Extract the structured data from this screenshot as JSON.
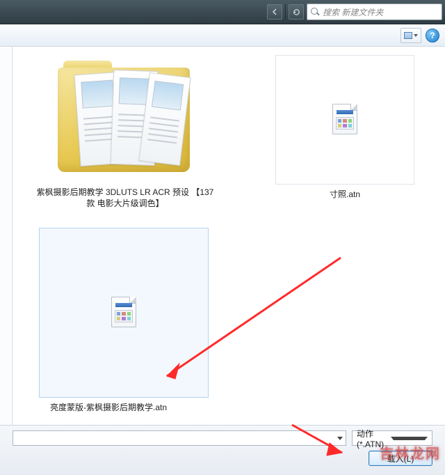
{
  "titlebar": {
    "search_placeholder": "搜索 新建文件夹"
  },
  "toolbar": {
    "help_label": "?"
  },
  "files": {
    "folder1_label": "紫枫摄影后期教学 3DLUTS LR ACR 预设 【137款 电影大片级调色】",
    "atn_right_label": "寸照.atn",
    "atn_selected_label": "亮度蒙版-紫枫摄影后期教学.atn"
  },
  "bottom": {
    "filter_label": "动作 (*.ATN)",
    "load_label": "载入(L)"
  },
  "watermark": {
    "text": "吉林龙网"
  }
}
